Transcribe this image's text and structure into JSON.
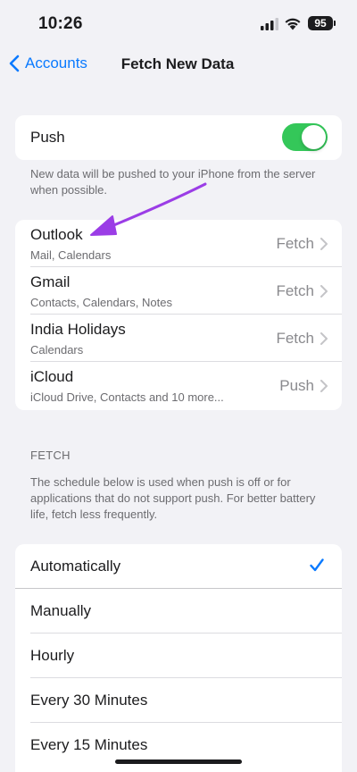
{
  "status_bar": {
    "time": "10:26",
    "battery": "95"
  },
  "nav": {
    "back_label": "Accounts",
    "title": "Fetch New Data"
  },
  "push": {
    "label": "Push",
    "enabled": true,
    "note": "New data will be pushed to your iPhone from the server when possible."
  },
  "accounts": [
    {
      "name": "Outlook",
      "detail": "Mail, Calendars",
      "value": "Fetch"
    },
    {
      "name": "Gmail",
      "detail": "Contacts, Calendars, Notes",
      "value": "Fetch"
    },
    {
      "name": "India Holidays",
      "detail": "Calendars",
      "value": "Fetch"
    },
    {
      "name": "iCloud",
      "detail": "iCloud Drive, Contacts and 10 more...",
      "value": "Push"
    }
  ],
  "fetch": {
    "header": "FETCH",
    "note": "The schedule below is used when push is off or for applications that do not support push. For better battery life, fetch less frequently.",
    "options": [
      {
        "label": "Automatically",
        "selected": true
      },
      {
        "label": "Manually",
        "selected": false
      },
      {
        "label": "Hourly",
        "selected": false
      },
      {
        "label": "Every 30 Minutes",
        "selected": false
      },
      {
        "label": "Every 15 Minutes",
        "selected": false
      }
    ]
  },
  "colors": {
    "accent": "#0a7aff",
    "toggle_on": "#34c759",
    "annotation_arrow": "#9b3de6",
    "background": "#f2f2f6"
  },
  "icons": [
    "signal-icon",
    "wifi-icon",
    "battery-icon",
    "chevron-left-icon",
    "chevron-right-icon",
    "checkmark-icon",
    "annotation-arrow"
  ]
}
